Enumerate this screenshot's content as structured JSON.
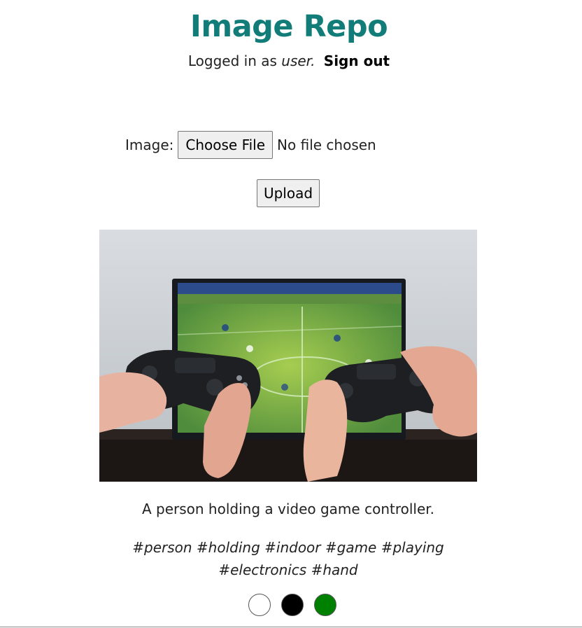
{
  "header": {
    "title": "Image Repo",
    "logged_in_prefix": "Logged in as",
    "username": "user.",
    "sign_out": "Sign out"
  },
  "upload_form": {
    "image_label": "Image:",
    "choose_file_button": "Choose File",
    "file_status": "No file chosen",
    "upload_button": "Upload"
  },
  "image_card": {
    "caption": "A person holding a video game controller.",
    "tags": "#person #holding #indoor #game #playing #electronics #hand",
    "colors": [
      "#ffffff",
      "#000000",
      "#008000"
    ]
  },
  "theme": {
    "title_color": "#127c78"
  }
}
